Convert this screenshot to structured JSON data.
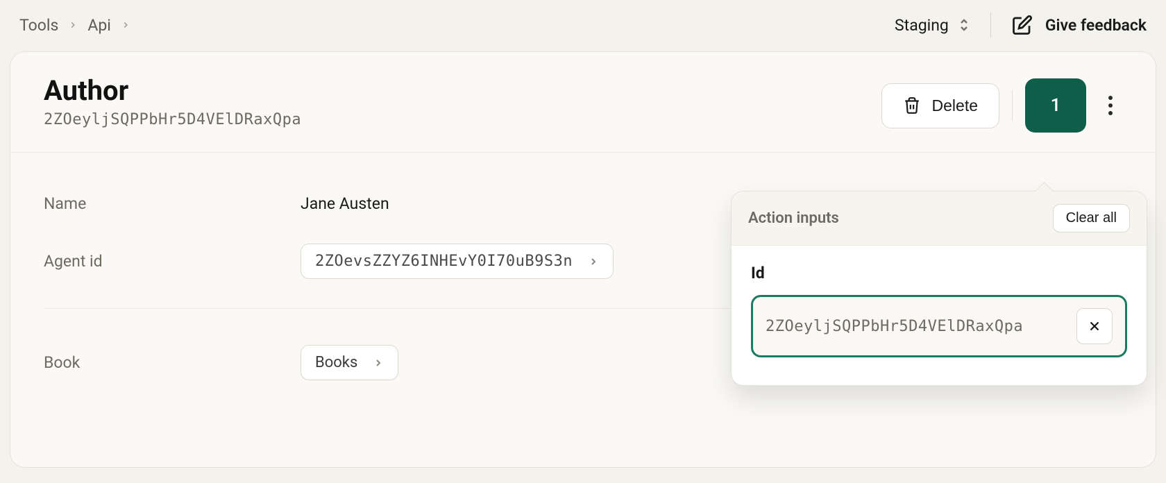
{
  "breadcrumb": {
    "items": [
      "Tools",
      "Api"
    ]
  },
  "topbar": {
    "environment": "Staging",
    "feedback_label": "Give feedback"
  },
  "page": {
    "title": "Author",
    "subtitle_id": "2ZOeyljSQPPbHr5D4VElDRaxQpa"
  },
  "actions": {
    "delete_label": "Delete",
    "badge_count": "1"
  },
  "fields": {
    "name": {
      "label": "Name",
      "value": "Jane Austen"
    },
    "agent_id": {
      "label": "Agent id",
      "value": "2ZOevsZZYZ6INHEvY0I70uB9S3n"
    },
    "book": {
      "label": "Book",
      "value": "Books"
    }
  },
  "popover": {
    "title": "Action inputs",
    "clear_all_label": "Clear all",
    "id_label": "Id",
    "id_value": "2ZOeyljSQPPbHr5D4VElDRaxQpa"
  }
}
